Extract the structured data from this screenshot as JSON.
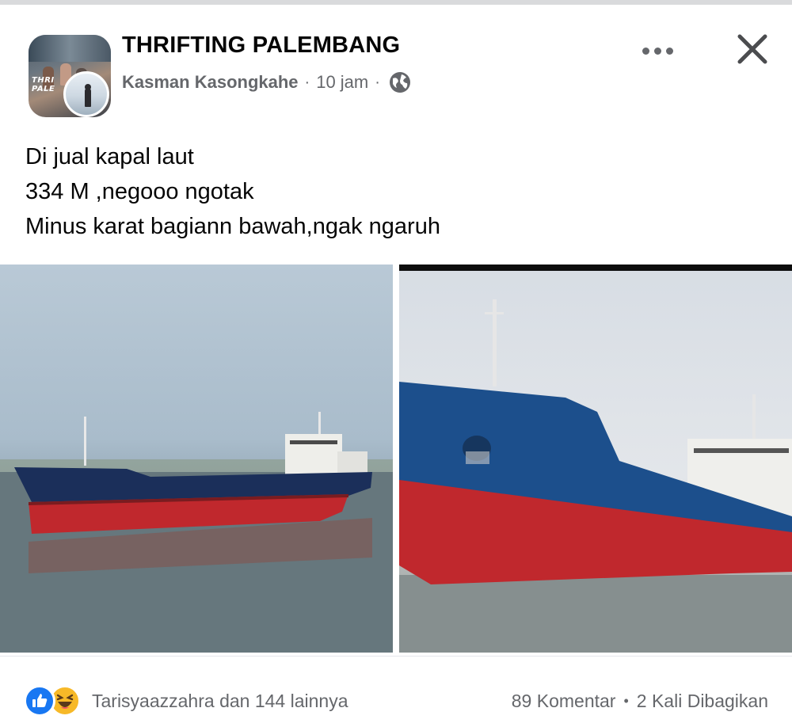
{
  "post": {
    "group_name": "THRIFTING PALEMBANG",
    "group_logo_text": "THRI\nPALE",
    "author": "Kasman Kasongkahe",
    "separator": "·",
    "time": "10 jam",
    "audience_icon": "globe-icon",
    "text_lines": [
      "Di jual kapal laut",
      "334 M ,negooo ngotak",
      "Minus karat bagiann bawah,ngak ngaruh"
    ]
  },
  "actions": {
    "more_icon": "more-horizontal-icon",
    "close_icon": "close-icon"
  },
  "footer": {
    "reaction_icons": [
      "like-icon",
      "haha-icon"
    ],
    "reaction_text": "Tarisyaazzahra dan 144 lainnya",
    "comments": "89 Komentar",
    "bullet": "•",
    "shares": "2 Kali Dibagikan"
  },
  "colors": {
    "accent_blue": "#1877f2",
    "haha_yellow": "#f7b928",
    "secondary_text": "#65676b",
    "hull_red": "#c0282d",
    "hull_blue": "#1c4f8c"
  }
}
